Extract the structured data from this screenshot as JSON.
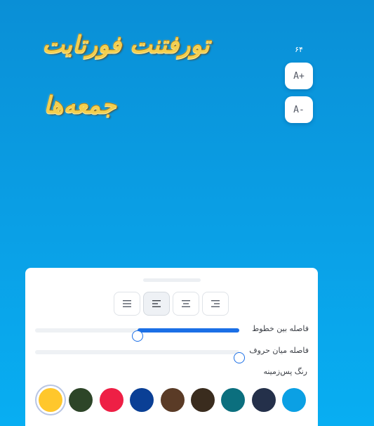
{
  "canvas": {
    "line1": "تورفتنت فورتایت",
    "line2": "جمعه‌ها"
  },
  "font_size": {
    "value": "۶۴",
    "increase_label": "A+",
    "decrease_label": "A-"
  },
  "panel": {
    "alignment": {
      "options": [
        "justify",
        "left",
        "center",
        "right"
      ],
      "selected": "left"
    },
    "line_spacing": {
      "label": "فاصله بین خطوط",
      "value_fraction": 0.5
    },
    "letter_spacing": {
      "label": "فاصله میان حروف",
      "value_fraction": 1.0
    },
    "background_color": {
      "label": "رنگ پس‌زمینه",
      "options": [
        {
          "color": "#ffc72c",
          "selected": true
        },
        {
          "color": "#2d4528",
          "selected": false
        },
        {
          "color": "#ee1f45",
          "selected": false
        },
        {
          "color": "#0a3f95",
          "selected": false
        },
        {
          "color": "#5a3b26",
          "selected": false
        },
        {
          "color": "#3a2c1e",
          "selected": false
        },
        {
          "color": "#0b6f7e",
          "selected": false
        },
        {
          "color": "#24304a",
          "selected": false
        },
        {
          "color": "#0ba0e4",
          "selected": false
        }
      ]
    }
  },
  "colors": {
    "accent": "#1b6fe6",
    "background_gradient": [
      "#0a8fd6",
      "#08aef2"
    ]
  }
}
